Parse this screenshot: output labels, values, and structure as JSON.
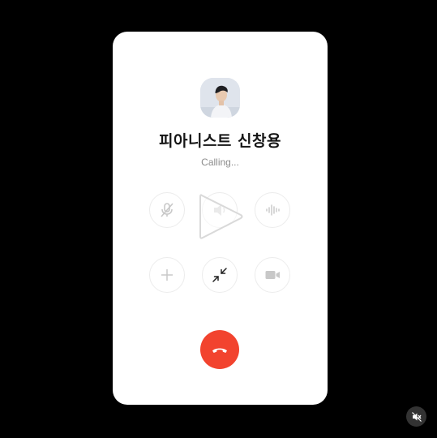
{
  "call": {
    "contact_name": "피아니스트 신창용",
    "status": "Calling..."
  },
  "controls": {
    "row1": [
      "mic-off-icon",
      "speaker-icon",
      "voice-wave-icon"
    ],
    "row2": [
      "add-icon",
      "minimize-icon",
      "video-icon"
    ]
  },
  "icons": {
    "end_call": "phone-hangup-icon",
    "play": "play-icon",
    "video_mute": "speaker-muted-icon"
  },
  "colors": {
    "background": "#000000",
    "card": "#ffffff",
    "end_call": "#f2432e",
    "disabled_icon": "#c8c8c8",
    "active_icon": "#222222",
    "status_text": "#8c8c8c"
  }
}
